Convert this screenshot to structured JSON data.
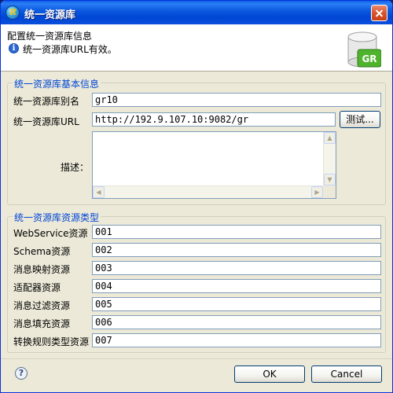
{
  "window": {
    "title": "统一资源库",
    "icon": "gr-app-icon",
    "icon_glyph": "R"
  },
  "header": {
    "title": "配置统一资源库信息",
    "message": "统一资源库URL有效。",
    "info_icon_glyph": "i",
    "db_icon_label": "GR"
  },
  "basic_info": {
    "group_title": "统一资源库基本信息",
    "alias_label": "统一资源库别名",
    "alias_value": "gr10",
    "url_label": "统一资源库URL",
    "url_value": "http://192.9.107.10:9082/gr",
    "test_button": "测试...",
    "desc_label": "描述：",
    "desc_value": ""
  },
  "resource_types": {
    "group_title": "统一资源库资源类型",
    "rows": [
      {
        "label": "WebService资源",
        "value": "001"
      },
      {
        "label": "Schema资源",
        "value": "002"
      },
      {
        "label": "消息映射资源",
        "value": "003"
      },
      {
        "label": "适配器资源",
        "value": "004"
      },
      {
        "label": "消息过滤资源",
        "value": "005"
      },
      {
        "label": "消息填充资源",
        "value": "006"
      },
      {
        "label": "转换规则类型资源",
        "value": "007"
      }
    ]
  },
  "footer": {
    "help_glyph": "?",
    "ok_button": "OK",
    "cancel_button": "Cancel"
  },
  "scroll_glyphs": {
    "up": "▲",
    "down": "▼",
    "left": "◀",
    "right": "▶"
  }
}
